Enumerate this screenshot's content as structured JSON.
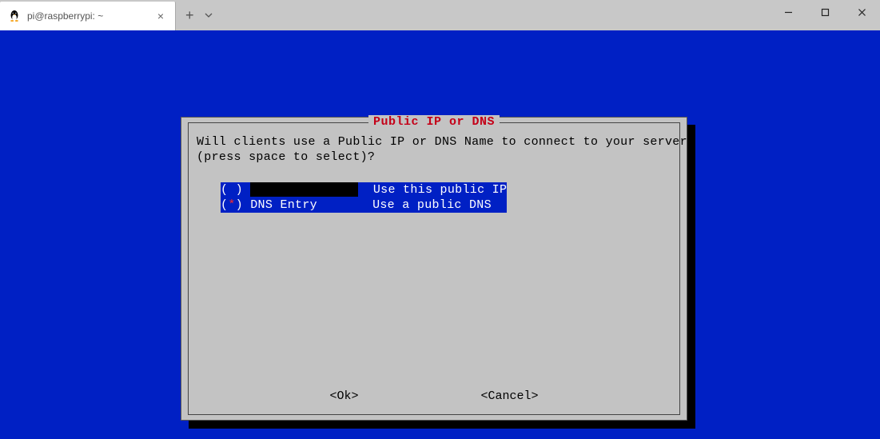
{
  "window": {
    "tab_title": "pi@raspberrypi: ~"
  },
  "dialog": {
    "title": " Public IP or DNS ",
    "prompt_line1": "Will clients use a Public IP or DNS Name to connect to your server",
    "prompt_line2": "(press space to select)?",
    "options": [
      {
        "mark": " ",
        "label_redacted": true,
        "label": "",
        "desc": "Use this public IP"
      },
      {
        "mark": "*",
        "label_redacted": false,
        "label": "DNS Entry",
        "desc": "Use a public DNS"
      }
    ],
    "ok": "<Ok>",
    "cancel": "<Cancel>"
  }
}
